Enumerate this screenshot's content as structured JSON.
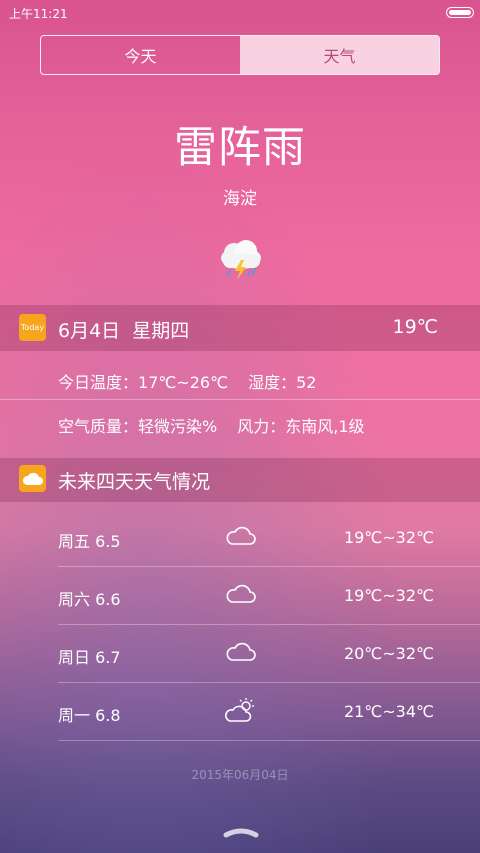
{
  "status": {
    "time": "上午11:21"
  },
  "tabs": [
    {
      "label": "今天"
    },
    {
      "label": "天气"
    }
  ],
  "weather": {
    "condition": "雷阵雨",
    "city": "海淀",
    "icon": "thunderstorm-icon"
  },
  "today": {
    "badge": "Today",
    "date": "6月4日",
    "weekday": "星期四",
    "current_temp": "19℃",
    "temp_label": "今日温度：",
    "temp_range": "17℃~26℃",
    "humidity_label": "湿度：",
    "humidity": "52",
    "air_label": "空气质量：",
    "air": "轻微污染%",
    "wind_label": "风力：",
    "wind": "东南风,1级"
  },
  "forecast": {
    "title": "未来四天天气情况",
    "days": [
      {
        "day": "周五 6.5",
        "icon": "cloud-icon",
        "temp": "19℃~32℃"
      },
      {
        "day": "周六 6.6",
        "icon": "cloud-icon",
        "temp": "19℃~32℃"
      },
      {
        "day": "周日 6.7",
        "icon": "cloud-icon",
        "temp": "20℃~32℃"
      },
      {
        "day": "周一 6.8",
        "icon": "partly-sunny-icon",
        "temp": "21℃~34℃"
      }
    ]
  },
  "footer": {
    "date": "2015年06月04日"
  },
  "colors": {
    "accent": "#f7a51c",
    "active_tab_bg": "#f9d2e2",
    "active_tab_text": "#b54c7a"
  }
}
